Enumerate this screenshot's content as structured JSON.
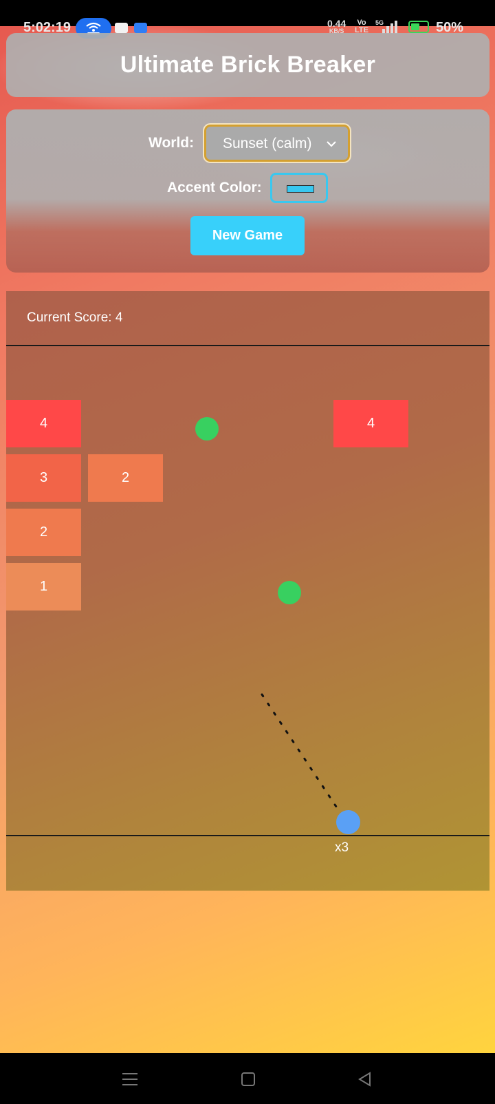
{
  "status_bar": {
    "time": "5:02:19",
    "net_speed_value": "0.44",
    "net_speed_unit": "KB/S",
    "volte_top": "Vo",
    "volte_bottom": "LTE",
    "signal_label": "5G",
    "battery_percent": "50%",
    "battery_level": 0.5,
    "icons": [
      "hotspot-icon",
      "message-icon",
      "android-icon",
      "signal-icon",
      "battery-charging-icon"
    ]
  },
  "header": {
    "title": "Ultimate Brick Breaker"
  },
  "settings": {
    "world_label": "World:",
    "world_value": "Sunset (calm)",
    "accent_label": "Accent Color:",
    "accent_color": "#38c8f0",
    "new_game_label": "New Game"
  },
  "game": {
    "score_text": "Current Score: 4",
    "multiplier_text": "x3",
    "bricks": [
      {
        "col": 0,
        "row": 0,
        "value": "4",
        "color": "#ff4848"
      },
      {
        "col": 4,
        "row": 0,
        "value": "4",
        "color": "#ff4848"
      },
      {
        "col": 0,
        "row": 1,
        "value": "3",
        "color": "#f26448"
      },
      {
        "col": 1,
        "row": 1,
        "value": "2",
        "color": "#ef7a4e"
      },
      {
        "col": 0,
        "row": 2,
        "value": "2",
        "color": "#ef7a4e"
      },
      {
        "col": 0,
        "row": 3,
        "value": "1",
        "color": "#ec8c58"
      }
    ],
    "colors": {
      "powerup": "#38d060",
      "ball": "#5aa0f5"
    }
  },
  "nav_bar": {
    "icons": [
      "menu-icon",
      "home-icon",
      "back-icon"
    ]
  }
}
